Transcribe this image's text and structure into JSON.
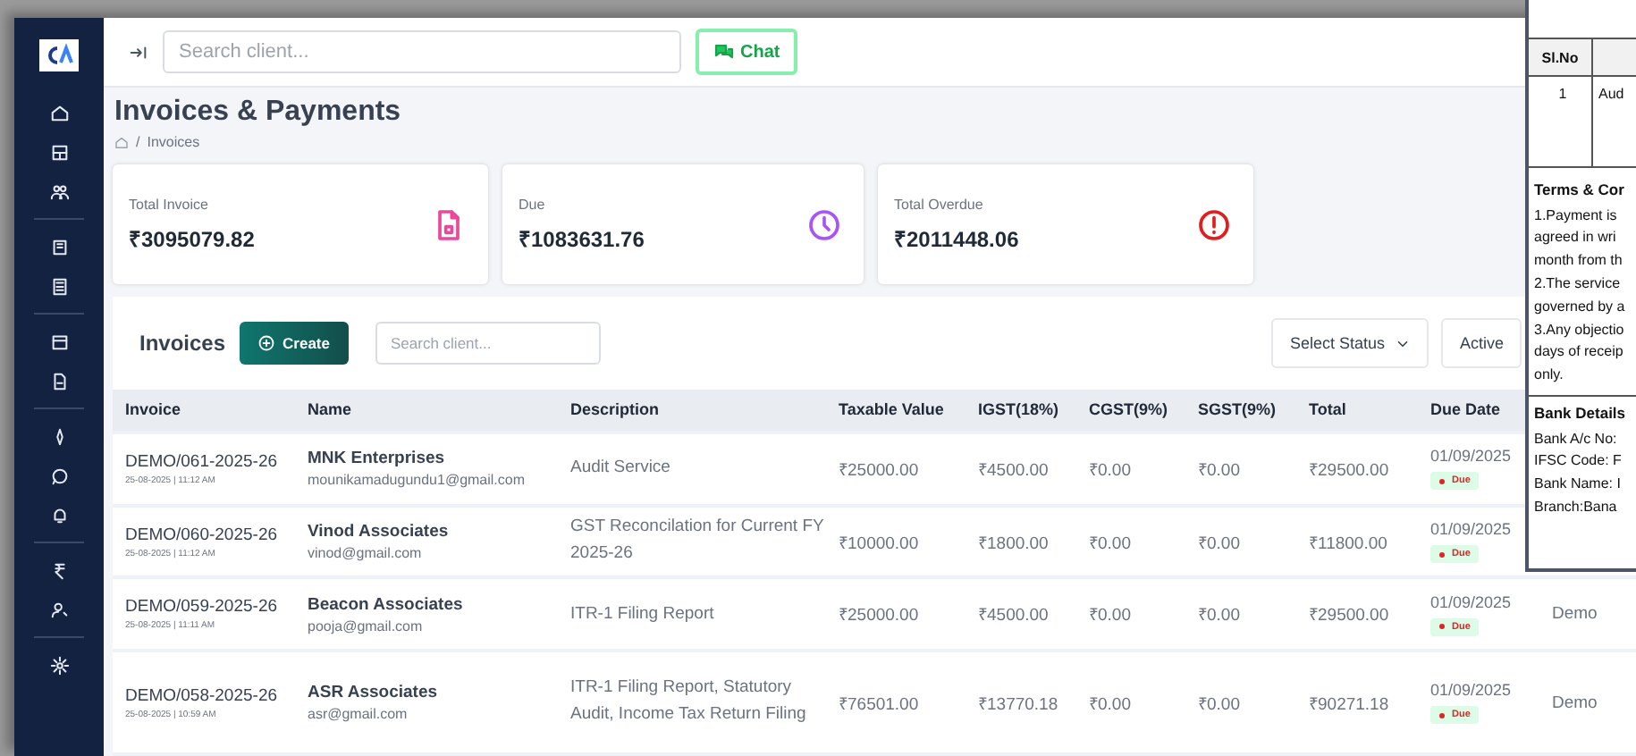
{
  "topbar": {
    "search": {
      "placeholder": "Search client..."
    },
    "chat_button": "Chat"
  },
  "page": {
    "title": "Invoices & Payments",
    "breadcrumb_separator": "/",
    "breadcrumb": [
      "Invoices"
    ]
  },
  "stats": [
    {
      "kind": "invoice",
      "label": "Total Invoice",
      "value": "₹3095079.82",
      "color": "#ec4899"
    },
    {
      "kind": "clock",
      "label": "Due",
      "value": "₹1083631.76",
      "color": "#a855f7"
    },
    {
      "kind": "alert",
      "label": "Total Overdue",
      "value": "₹2011448.06",
      "color": "#e11d1d"
    }
  ],
  "invoices": {
    "title": "Invoices",
    "create_button": "Create",
    "search": {
      "placeholder": "Search client..."
    },
    "status_select": "Select Status",
    "active_button": "Active",
    "columns": [
      "Invoice",
      "Name",
      "Description",
      "Taxable Value",
      "IGST(18%)",
      "CGST(9%)",
      "SGST(9%)",
      "Total",
      "Due Date"
    ],
    "rows": [
      {
        "invoice": "DEMO/061-2025-26",
        "datetime": "25-08-2025 | 11:12 AM",
        "name": "MNK Enterprises",
        "email": "mounikamadugundu1@gmail.com",
        "description": "Audit Service",
        "taxable": "₹25000.00",
        "igst": "₹4500.00",
        "cgst": "₹0.00",
        "sgst": "₹0.00",
        "total": "₹29500.00",
        "due_date": "01/09/2025",
        "status": "Due"
      },
      {
        "invoice": "DEMO/060-2025-26",
        "datetime": "25-08-2025 | 11:12 AM",
        "name": "Vinod Associates",
        "email": "vinod@gmail.com",
        "description": "GST Reconcilation for Current FY 2025-26",
        "taxable": "₹10000.00",
        "igst": "₹1800.00",
        "cgst": "₹0.00",
        "sgst": "₹0.00",
        "total": "₹11800.00",
        "due_date": "01/09/2025",
        "status": "Due"
      },
      {
        "invoice": "DEMO/059-2025-26",
        "datetime": "25-08-2025 | 11:11 AM",
        "name": "Beacon Associates",
        "email": "pooja@gmail.com",
        "description": "ITR-1 Filing Report",
        "taxable": "₹25000.00",
        "igst": "₹4500.00",
        "cgst": "₹0.00",
        "sgst": "₹0.00",
        "total": "₹29500.00",
        "due_date": "01/09/2025",
        "status": "Due",
        "column_10": "Demo"
      },
      {
        "invoice": "DEMO/058-2025-26",
        "datetime": "25-08-2025 | 10:59 AM",
        "name": "ASR Associates",
        "email": "asr@gmail.com",
        "description": "ITR-1 Filing Report, Statutory Audit, Income Tax Return Filing",
        "taxable": "₹76501.00",
        "igst": "₹13770.18",
        "cgst": "₹0.00",
        "sgst": "₹0.00",
        "total": "₹90271.18",
        "due_date": "01/09/2025",
        "status": "Due",
        "column_10": "Demo"
      }
    ]
  },
  "document_preview": {
    "table_header": "Sl.No",
    "table_row": [
      "1",
      "Aud"
    ],
    "terms_title": "Terms & Cor",
    "terms_lines": [
      "1.Payment is",
      "agreed in wri",
      "month from th",
      "2.The service",
      "governed by a",
      "3.Any objectio",
      "days of receip",
      "only."
    ],
    "bank_title": "Bank Details",
    "bank_lines": [
      "Bank A/c No:",
      "IFSC Code: F",
      "Bank Name: I",
      "Branch:Bana"
    ]
  }
}
